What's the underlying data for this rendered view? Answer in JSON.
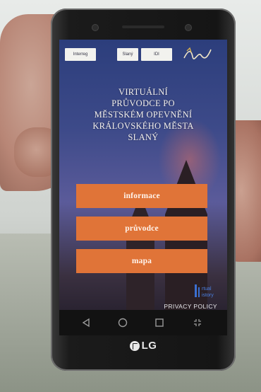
{
  "app": {
    "title_lines": [
      "VIRTUÁLNÍ",
      "PRŮVODCE PO",
      "MĚSTSKÉM OPEVNĚNÍ",
      "KRÁLOVSKÉHO MĚSTA",
      "SLANÝ"
    ]
  },
  "logos": [
    {
      "name": "interreg-logo",
      "text": "Interreg"
    },
    {
      "name": "partner-logo-2",
      "text": "Slaný"
    },
    {
      "name": "partner-logo-3",
      "text": "IDI"
    },
    {
      "name": "signature-logo",
      "text": ""
    }
  ],
  "menu": {
    "info_label": "informace",
    "guide_label": "průvodce",
    "map_label": "mapa"
  },
  "footer": {
    "privacy_label": "PRIVACY POLICY",
    "vh_logo_text": "Virtual History"
  },
  "device": {
    "brand": "LG"
  },
  "colors": {
    "button": "#e07438",
    "screen_top": "#2c3e7c"
  }
}
